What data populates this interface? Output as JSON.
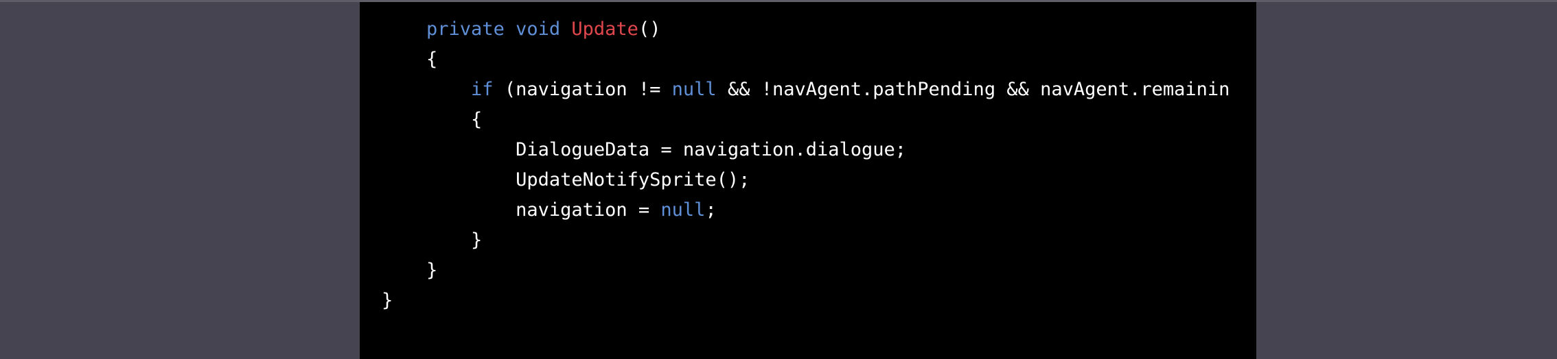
{
  "colors": {
    "background": "#454450",
    "code_background": "#000000",
    "keyword": "#5f8fd6",
    "function": "#e0474c",
    "text": "#ffffff"
  },
  "code": {
    "lines": [
      {
        "indent": "    ",
        "tokens": [
          {
            "t": "private",
            "k": "kw"
          },
          {
            "t": " ",
            "k": "plain"
          },
          {
            "t": "void",
            "k": "kw"
          },
          {
            "t": " ",
            "k": "plain"
          },
          {
            "t": "Update",
            "k": "fn"
          },
          {
            "t": "()",
            "k": "plain"
          }
        ]
      },
      {
        "indent": "    ",
        "tokens": [
          {
            "t": "{",
            "k": "plain"
          }
        ]
      },
      {
        "indent": "        ",
        "tokens": [
          {
            "t": "if",
            "k": "kw"
          },
          {
            "t": " (navigation != ",
            "k": "plain"
          },
          {
            "t": "null",
            "k": "kw"
          },
          {
            "t": " && !navAgent.pathPending && navAgent.remainin",
            "k": "plain"
          }
        ]
      },
      {
        "indent": "        ",
        "tokens": [
          {
            "t": "{",
            "k": "plain"
          }
        ]
      },
      {
        "indent": "            ",
        "tokens": [
          {
            "t": "DialogueData = navigation.dialogue;",
            "k": "plain"
          }
        ]
      },
      {
        "indent": "            ",
        "tokens": [
          {
            "t": "UpdateNotifySprite();",
            "k": "plain"
          }
        ]
      },
      {
        "indent": "            ",
        "tokens": [
          {
            "t": "navigation = ",
            "k": "plain"
          },
          {
            "t": "null",
            "k": "kw"
          },
          {
            "t": ";",
            "k": "plain"
          }
        ]
      },
      {
        "indent": "        ",
        "tokens": [
          {
            "t": "}",
            "k": "plain"
          }
        ]
      },
      {
        "indent": "    ",
        "tokens": [
          {
            "t": "}",
            "k": "plain"
          }
        ]
      },
      {
        "indent": "",
        "tokens": [
          {
            "t": "}",
            "k": "plain"
          }
        ]
      }
    ]
  }
}
